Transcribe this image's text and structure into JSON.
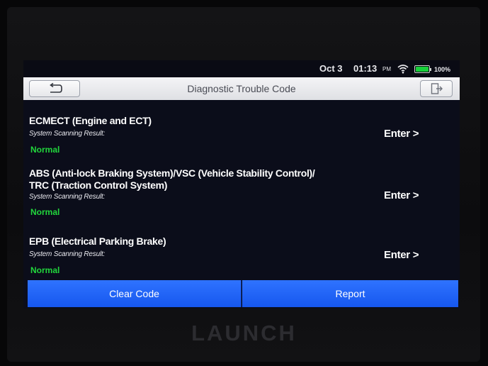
{
  "status_bar": {
    "date": "Oct 3",
    "time": "01:13",
    "ampm": "PM",
    "battery": "100%",
    "icons": {
      "wifi": "wifi-icon",
      "battery": "battery-icon"
    },
    "battery_color": "#18d03a"
  },
  "header": {
    "title": "Diagnostic Trouble Code",
    "icons": {
      "back": "back-arrow-icon",
      "exit": "exit-icon"
    }
  },
  "systems": [
    {
      "name_lines": [
        "ECMECT (Engine and ECT)"
      ],
      "label": "System Scanning Result:",
      "status": "Normal",
      "action": "Enter >"
    },
    {
      "name_lines": [
        "ABS (Anti-lock Braking System)/VSC (Vehicle Stability Control)/",
        "TRC (Traction Control System)"
      ],
      "label": "System Scanning Result:",
      "status": "Normal",
      "action": "Enter >"
    },
    {
      "name_lines": [
        "EPB (Electrical Parking Brake)"
      ],
      "label": "System Scanning Result:",
      "status": "Normal",
      "action": "Enter >"
    }
  ],
  "buttons": {
    "clear_code": "Clear Code",
    "report": "Report"
  },
  "brand": "LAUNCH",
  "colors": {
    "accent_blue": "#1f63f5",
    "status_normal": "#21d63c",
    "screen_bg": "#0b0d1a"
  }
}
